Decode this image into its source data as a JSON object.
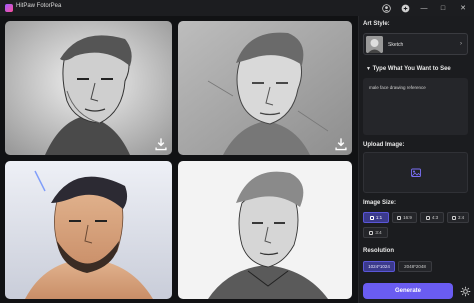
{
  "app": {
    "title": "HitPaw FotorPea"
  },
  "titlebar": {
    "icons": [
      "user-icon",
      "settings-icon",
      "minimize-icon",
      "maximize-icon",
      "close-icon"
    ]
  },
  "gallery": {
    "images": [
      {
        "name": "sketch-result-1",
        "tone": "grayscale"
      },
      {
        "name": "sketch-result-2",
        "tone": "grayscale"
      },
      {
        "name": "sketch-result-3",
        "tone": "color"
      },
      {
        "name": "sketch-result-4",
        "tone": "grayscale"
      }
    ],
    "download_icon": "download-icon"
  },
  "panel": {
    "art_style_label": "Art Style:",
    "style_name": "Sketch",
    "prompt_label": "Type What You Want to See",
    "prompt_text": "male face drawing reference",
    "upload_label": "Upload Image:",
    "image_size_label": "Image Size:",
    "ratios": [
      "1:1",
      "16:9",
      "4:3",
      "3:4"
    ],
    "ratios_row2": [
      "3:4"
    ],
    "selected_ratio": "1:1",
    "resolution_label": "Resolution",
    "resolutions": [
      "1024*1024",
      "2048*2048"
    ],
    "selected_resolution": "1024*1024",
    "generate_label": "Generate"
  },
  "colors": {
    "accent": "#6a5cf2",
    "panel": "#1b1c1f",
    "background": "#111214"
  }
}
